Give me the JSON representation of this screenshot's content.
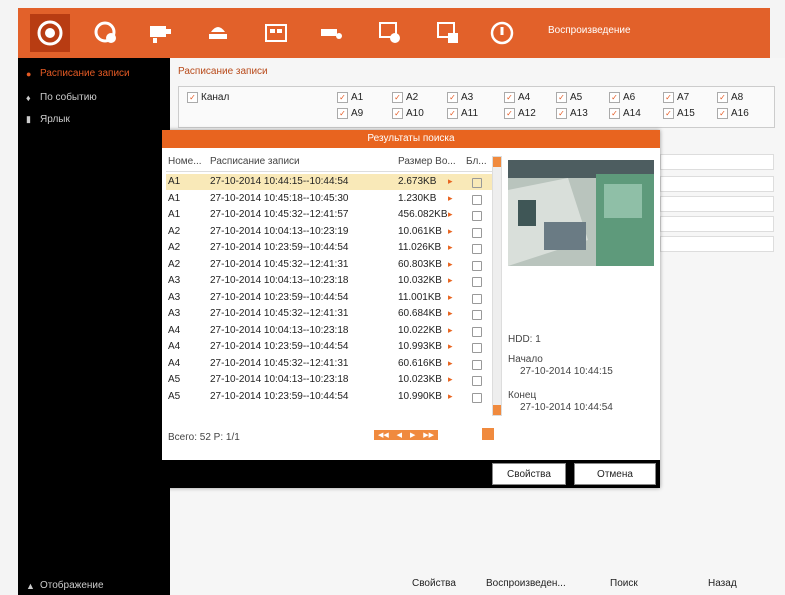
{
  "toolbar": {
    "title": "Воспроизведение",
    "buttons": [
      "playback-icon",
      "search-camera-icon",
      "camera-settings-icon",
      "alarm-icon",
      "video-list-icon",
      "camera-icon",
      "hdd-settings-icon",
      "backup-icon",
      "power-icon"
    ]
  },
  "sidebar": {
    "items": [
      {
        "label": "Расписание записи",
        "icon": "circle-icon"
      },
      {
        "label": "По событию",
        "icon": "pin-icon"
      },
      {
        "label": "Ярлык",
        "icon": "tag-icon"
      }
    ],
    "footer": "Отображение"
  },
  "main": {
    "title": "Расписание записи",
    "channel_label": "Канал",
    "channels": [
      "A1",
      "A2",
      "A3",
      "A4",
      "A5",
      "A6",
      "A7",
      "A8",
      "A9",
      "A10",
      "A11",
      "A12",
      "A13",
      "A14",
      "A15",
      "A16"
    ]
  },
  "bottom": {
    "properties": "Свойства",
    "playback": "Воспроизведен...",
    "search": "Поиск",
    "back": "Назад"
  },
  "dialog": {
    "title": "Результаты поиска",
    "columns": [
      "Номе...",
      "Расписание записи",
      "Размер Во...",
      "Бл..."
    ],
    "rows": [
      {
        "num": "A1",
        "time": "27-10-2014 10:44:15--10:44:54",
        "size": "2.673KB"
      },
      {
        "num": "A1",
        "time": "27-10-2014 10:45:18--10:45:30",
        "size": "1.230KB"
      },
      {
        "num": "A1",
        "time": "27-10-2014 10:45:32--12:41:57",
        "size": "456.082KB"
      },
      {
        "num": "A2",
        "time": "27-10-2014 10:04:13--10:23:19",
        "size": "10.061KB"
      },
      {
        "num": "A2",
        "time": "27-10-2014 10:23:59--10:44:54",
        "size": "11.026KB"
      },
      {
        "num": "A2",
        "time": "27-10-2014 10:45:32--12:41:31",
        "size": "60.803KB"
      },
      {
        "num": "A3",
        "time": "27-10-2014 10:04:13--10:23:18",
        "size": "10.032KB"
      },
      {
        "num": "A3",
        "time": "27-10-2014 10:23:59--10:44:54",
        "size": "11.001KB"
      },
      {
        "num": "A3",
        "time": "27-10-2014 10:45:32--12:41:31",
        "size": "60.684KB"
      },
      {
        "num": "A4",
        "time": "27-10-2014 10:04:13--10:23:18",
        "size": "10.022KB"
      },
      {
        "num": "A4",
        "time": "27-10-2014 10:23:59--10:44:54",
        "size": "10.993KB"
      },
      {
        "num": "A4",
        "time": "27-10-2014 10:45:32--12:41:31",
        "size": "60.616KB"
      },
      {
        "num": "A5",
        "time": "27-10-2014 10:04:13--10:23:18",
        "size": "10.023KB"
      },
      {
        "num": "A5",
        "time": "27-10-2014 10:23:59--10:44:54",
        "size": "10.990KB"
      }
    ],
    "total": "Всего: 52  P: 1/1",
    "hdd": "HDD: 1",
    "start_label": "Начало",
    "start_value": "27-10-2014 10:44:15",
    "end_label": "Конец",
    "end_value": "27-10-2014 10:44:54",
    "properties_button": "Свойства",
    "cancel_button": "Отмена"
  },
  "colors": {
    "accent": "#e2612a",
    "dark": "#000000",
    "selected_row": "#f9e9b8"
  }
}
